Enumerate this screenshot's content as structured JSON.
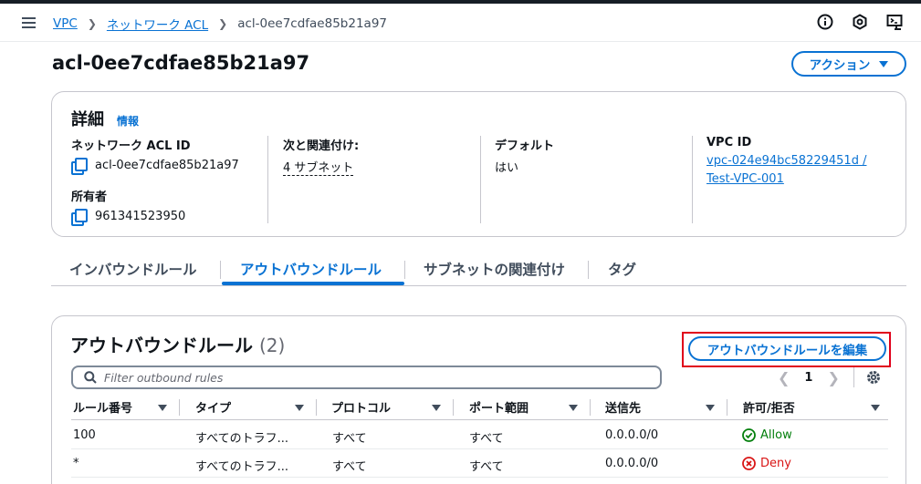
{
  "breadcrumbs": [
    {
      "label": "VPC"
    },
    {
      "label": "ネットワーク ACL"
    },
    {
      "label": "acl-0ee7cdfae85b21a97"
    }
  ],
  "page": {
    "title": "acl-0ee7cdfae85b21a97",
    "actions_label": "アクション"
  },
  "details": {
    "title": "詳細",
    "info": "情報",
    "acl_id_label": "ネットワーク ACL ID",
    "acl_id_value": "acl-0ee7cdfae85b21a97",
    "owner_label": "所有者",
    "owner_value": "961341523950",
    "assoc_label": "次と関連付け:",
    "assoc_value": "4 サブネット",
    "default_label": "デフォルト",
    "default_value": "はい",
    "vpc_label": "VPC ID",
    "vpc_value_line1": "vpc-024e94bc58229451d /",
    "vpc_value_line2": "Test-VPC-001"
  },
  "tabs": [
    {
      "label": "インバウンドルール"
    },
    {
      "label": "アウトバウンドルール"
    },
    {
      "label": "サブネットの関連付け"
    },
    {
      "label": "タグ"
    }
  ],
  "rules": {
    "title": "アウトバウンドルール",
    "count": "(2)",
    "edit_label": "アウトバウンドルールを編集",
    "filter_placeholder": "Filter outbound rules",
    "page_number": "1",
    "columns": [
      "ルール番号",
      "タイプ",
      "プロトコル",
      "ポート範囲",
      "送信先",
      "許可/拒否"
    ],
    "rows": [
      {
        "rule": "100",
        "type": "すべてのトラフ...",
        "protocol": "すべて",
        "port": "すべて",
        "dest": "0.0.0.0/0",
        "action": "Allow"
      },
      {
        "rule": "*",
        "type": "すべてのトラフ...",
        "protocol": "すべて",
        "port": "すべて",
        "dest": "0.0.0.0/0",
        "action": "Deny"
      }
    ]
  },
  "colors": {
    "link": "#0972d3",
    "allow": "#037f0c",
    "deny": "#d91515",
    "highlight": "#e0001b"
  },
  "icons": [
    "menu-icon",
    "info-icon",
    "notifications-icon",
    "cloudshell-icon",
    "copy-icon",
    "search-icon",
    "settings-icon",
    "allow-icon",
    "deny-icon"
  ]
}
